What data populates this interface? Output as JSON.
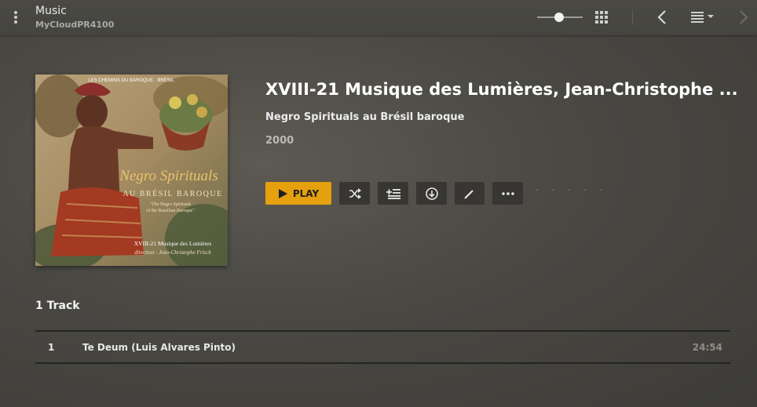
{
  "header": {
    "title": "Music",
    "subtitle": "MyCloudPR4100",
    "icons": [
      "more-vertical-icon",
      "size-slider",
      "grid-icon",
      "back-icon",
      "list-menu-icon",
      "forward-icon"
    ]
  },
  "album": {
    "cover_texts": {
      "top": "LES CHEMINS DU BAROQUE · BRÉSIL",
      "title_line1": "Negro Spirituals",
      "title_line2": "AU BRÉSIL BAROQUE",
      "subtitle_line1": "\"The Negro Spirituals",
      "subtitle_line2": "of the Brazilian Baroque\"",
      "ensemble": "XVIII-21 Musique des Lumières",
      "direction": "direction : Jean-Christophe Frisch"
    },
    "title": "XVIII-21 Musique des Lumières, Jean-Christophe ...",
    "artist": "Negro Spirituals au Brésil baroque",
    "year": "2000"
  },
  "actions": {
    "play_label": "PLAY",
    "buttons": [
      "shuffle-icon",
      "add-to-queue-icon",
      "download-icon",
      "edit-icon",
      "more-icon"
    ],
    "rating": "· · · · ·"
  },
  "tracks": {
    "count_label": "1 Track",
    "items": [
      {
        "number": "1",
        "title": "Te Deum (Luis Alvares Pinto)",
        "duration": "24:54"
      }
    ]
  },
  "colors": {
    "accent": "#e5a00d",
    "background": "#4a4843",
    "button_bg": "#373632"
  }
}
